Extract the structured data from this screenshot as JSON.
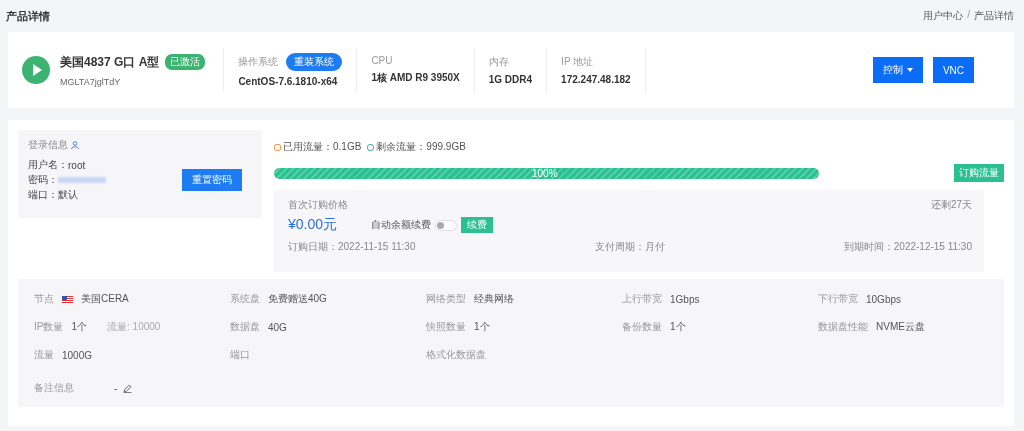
{
  "page_title": "产品详情",
  "breadcrumb": {
    "items": [
      "用户中心",
      "产品详情"
    ],
    "separator": "/"
  },
  "product": {
    "name": "美国4837 G口 A型",
    "status": "已激活",
    "code": "MGLTA7jglTdY",
    "fields": [
      {
        "label": "操作系统",
        "value": "CentOS-7.6.1810-x64",
        "action": "重装系统"
      },
      {
        "label": "CPU",
        "value": "1核 AMD R9 3950X"
      },
      {
        "label": "内存",
        "value": "1G DDR4"
      },
      {
        "label": "IP 地址",
        "value": "172.247.48.182"
      }
    ],
    "buttons": [
      {
        "label": "控制",
        "dropdown": true
      },
      {
        "label": "VNC",
        "dropdown": false
      }
    ]
  },
  "login": {
    "title": "登录信息",
    "rows": [
      {
        "label": "用户名：",
        "value": "root",
        "kind": "text"
      },
      {
        "label": "密码：",
        "kind": "hidden"
      },
      {
        "label": "端口：",
        "value": "默认",
        "kind": "text"
      }
    ],
    "button": "重置密码"
  },
  "traffic": {
    "used": "已用流量：0.1GB",
    "remaining": "剩余流量：999.9GB",
    "level": 1,
    "percent": "100%",
    "button": "订购流量"
  },
  "billing": {
    "title": "首次订购价格",
    "days_left": "还剩27天",
    "price": "¥0.00元",
    "auto_renew": {
      "label": "自动余额续费",
      "on": false
    },
    "renew_button": "续费",
    "dates": [
      "订购日期：2022-11-15 11:30",
      "支付周期：月付",
      "到期时间：2022-12-15 11:30"
    ]
  },
  "specs": [
    [
      {
        "label": "节点",
        "value": "美国CERA",
        "flag": true
      },
      {
        "label": "系统盘",
        "value": "免费赠送40G"
      },
      {
        "label": "网络类型",
        "value": "经典网络"
      },
      {
        "label": "上行带宽",
        "value": "1Gbps"
      },
      {
        "label": "下行带宽",
        "value": "10Gbps"
      }
    ],
    [
      {
        "label": "IP数量",
        "value": "1个",
        "extra": "流量: 10000"
      },
      {
        "label": "数据盘",
        "value": "40G"
      },
      {
        "label": "快照数量",
        "value": "1个"
      },
      {
        "label": "备份数量",
        "value": "1个"
      },
      {
        "label": "数据盘性能",
        "value": "NVME云盘"
      }
    ],
    [
      {
        "label": "流量",
        "value": "1000G"
      },
      {
        "label": "端口"
      },
      {
        "label": "格式化数据盘"
      }
    ]
  ],
  "note": {
    "label": "备注信息",
    "value": "-"
  }
}
